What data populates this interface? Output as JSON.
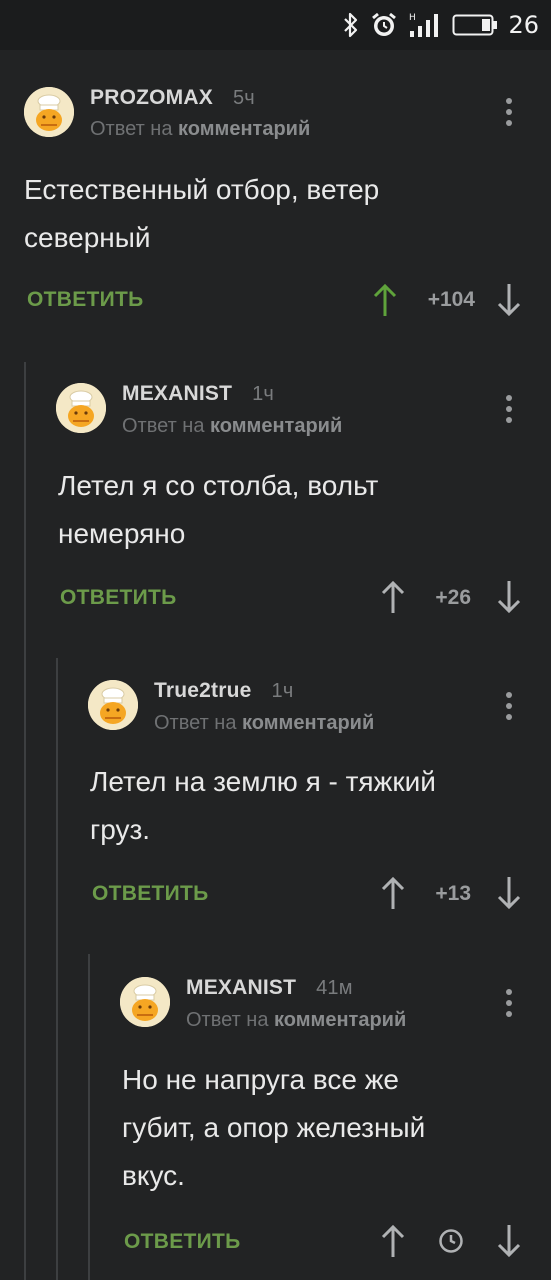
{
  "status_bar": {
    "battery_level": "26",
    "icons": [
      "bluetooth-icon",
      "alarm-icon",
      "signal-icon",
      "battery-icon"
    ]
  },
  "colors": {
    "background": "#222324",
    "accent_green": "#6c9b4a",
    "upvoted_green": "#5fa33b",
    "muted_text": "#6f7173"
  },
  "comments": [
    {
      "username": "PROZOMAX",
      "time": "5ч",
      "reply_prefix": "Ответ на",
      "reply_target": "комментарий",
      "text_lines": [
        "Естественный отбор, ветер",
        "северный"
      ],
      "reply_label": "ОТВЕТИТЬ",
      "rating": "+104",
      "upvoted": true
    },
    {
      "username": "MEXANIST",
      "time": "1ч",
      "reply_prefix": "Ответ на",
      "reply_target": "комментарий",
      "text_lines": [
        "Летел я со столба, вольт",
        "немеряно"
      ],
      "reply_label": "ОТВЕТИТЬ",
      "rating": "+26",
      "upvoted": false
    },
    {
      "username": "True2true",
      "time": "1ч",
      "reply_prefix": "Ответ на",
      "reply_target": "комментарий",
      "text_lines": [
        "Летел на землю я - тяжкий",
        "груз."
      ],
      "reply_label": "ОТВЕТИТЬ",
      "rating": "+13",
      "upvoted": false
    },
    {
      "username": "MEXANIST",
      "time": "41м",
      "reply_prefix": "Ответ на",
      "reply_target": "комментарий",
      "text_lines": [
        "Но не напруга все же",
        "губит, а опор железный",
        "вкус."
      ],
      "reply_label": "ОТВЕТИТЬ",
      "rating": "",
      "rating_hidden_icon": "clock-icon",
      "upvoted": false
    }
  ]
}
